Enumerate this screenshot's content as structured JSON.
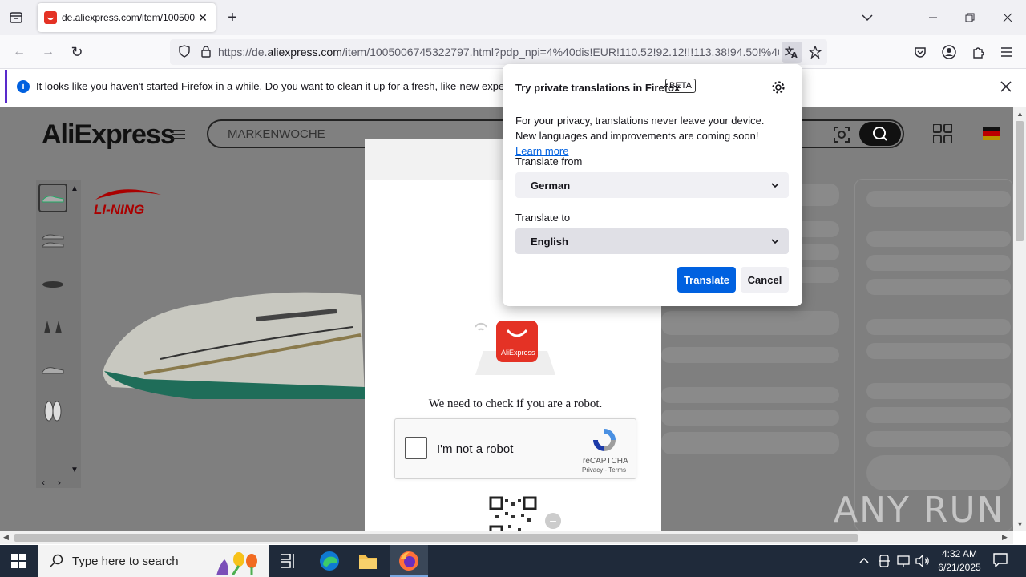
{
  "browser": {
    "tab_title": "de.aliexpress.com/item/100500",
    "url_prefix": "https://de.",
    "url_domain": "aliexpress.com",
    "url_rest": "/item/1005006745322797.html?pdp_npi=4%40dis!EUR!110.52!92.12!!!113.38!94.50!%402"
  },
  "notification": {
    "text": "It looks like you haven't started Firefox in a while. Do you want to clean it up for a fresh, like-new experience? A"
  },
  "page": {
    "logo": "AliExpress",
    "search_placeholder": "MARKENWOCHE",
    "brand": "LI-NING",
    "captcha": {
      "badge": "AliExpress",
      "message": "We need to check if you are a robot.",
      "checkbox_label": "I'm not a robot",
      "recaptcha_brand": "reCAPTCHA",
      "recaptcha_links": "Privacy - Terms"
    },
    "watermark": "ANY RUN"
  },
  "translation_panel": {
    "title": "Try private translations in Firefox",
    "beta": "BETA",
    "body": "For your privacy, translations never leave your device. New languages and improvements are coming soon!",
    "learn_more": "Learn more",
    "from_label": "Translate from",
    "from_value": "German",
    "to_label": "Translate to",
    "to_value": "English",
    "translate_btn": "Translate",
    "cancel_btn": "Cancel"
  },
  "taskbar": {
    "search_placeholder": "Type here to search",
    "time": "4:32 AM",
    "date": "6/21/2025"
  },
  "colors": {
    "accent": "#0061e0",
    "aliexpress_red": "#e43225",
    "taskbar": "#1f2a3a"
  }
}
